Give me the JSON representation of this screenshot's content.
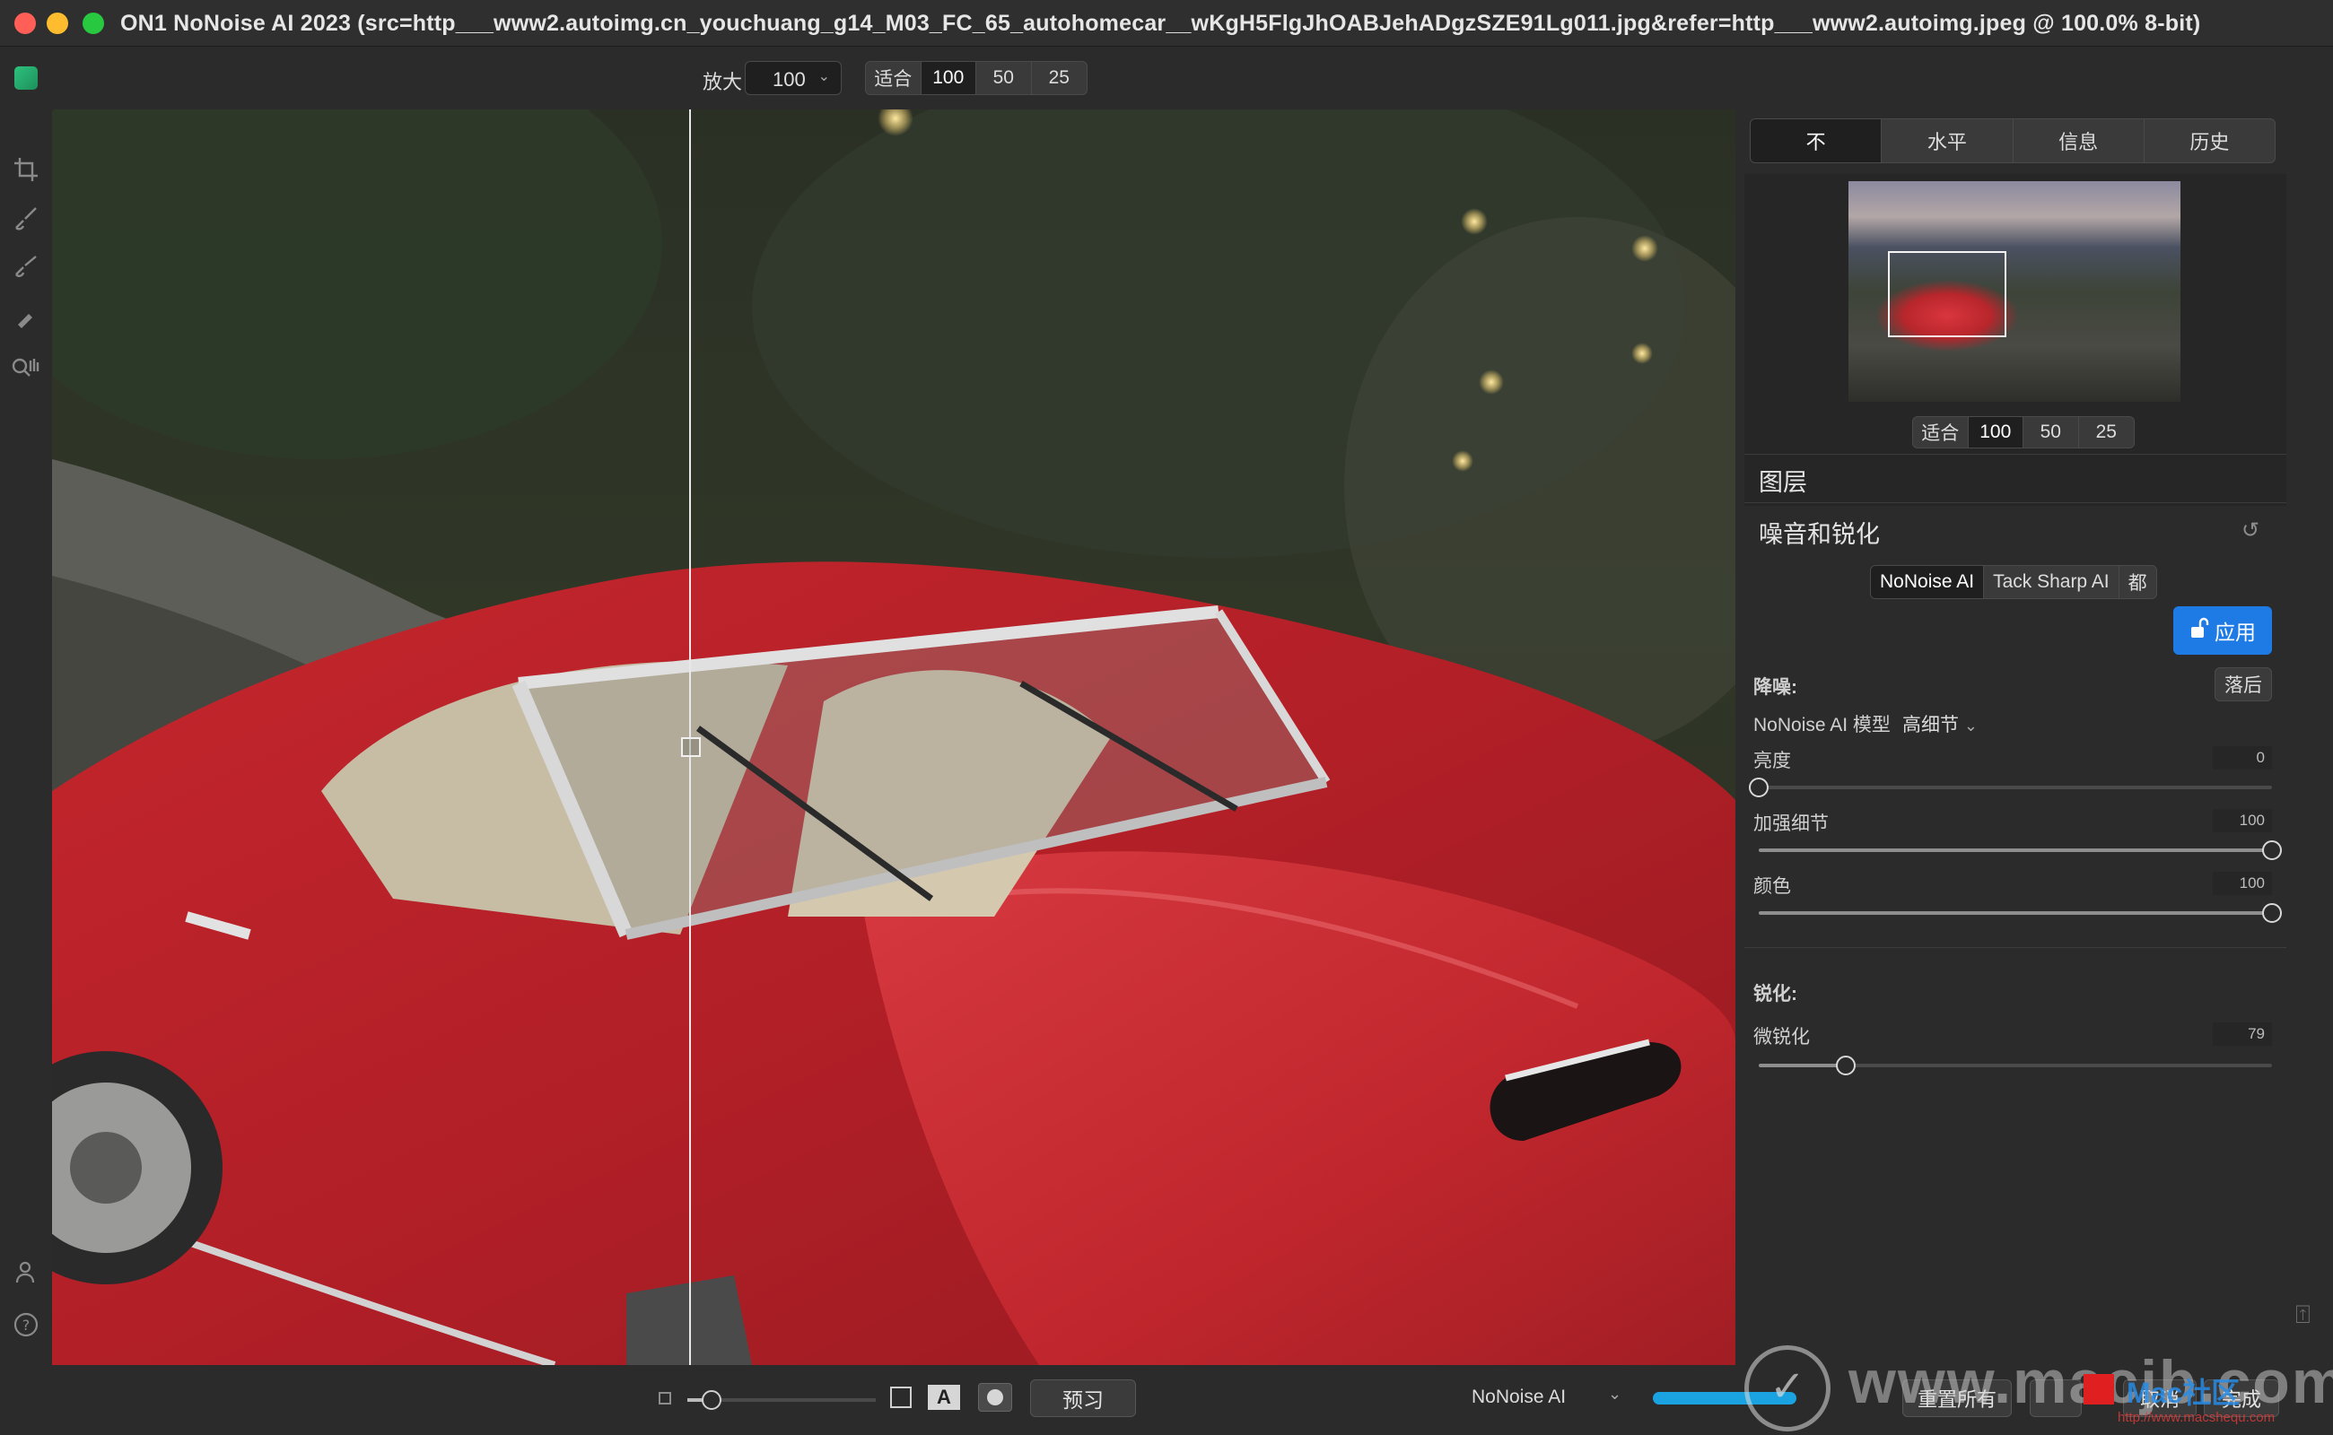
{
  "window": {
    "title": "ON1 NoNoise AI 2023 (src=http___www2.autoimg.cn_youchuang_g14_M03_FC_65_autohomecar__wKgH5FlgJhOABJehADgzSZE91Lg011.jpg&refer=http___www2.autoimg.jpeg @ 100.0% 8-bit)"
  },
  "toolbar": {
    "zoom_label": "放大",
    "zoom_value": "100",
    "zoom_presets": [
      "适合",
      "100",
      "50",
      "25"
    ],
    "zoom_active": "100"
  },
  "panel": {
    "tabs": [
      "不",
      "水平",
      "信息",
      "历史"
    ],
    "active_tab": "不",
    "navigator": {
      "zoom_presets": [
        "适合",
        "100",
        "50",
        "25"
      ],
      "zoom_active": "100"
    },
    "layers_title": "图层",
    "section_title": "噪音和锐化",
    "modes": [
      "NoNoise AI",
      "Tack Sharp AI",
      "都"
    ],
    "active_mode": "NoNoise AI",
    "apply_label": "应用",
    "denoise": {
      "heading": "降噪:",
      "reset_label": "落后",
      "model_label": "NoNoise AI 模型",
      "model_value": "高细节",
      "sliders": [
        {
          "label": "亮度",
          "value": "0",
          "percent": 0
        },
        {
          "label": "加强细节",
          "value": "100",
          "percent": 100
        },
        {
          "label": "颜色",
          "value": "100",
          "percent": 100
        }
      ]
    },
    "sharpen": {
      "heading": "锐化:",
      "sliders": [
        {
          "label": "微锐化",
          "value": "79",
          "percent": 17
        }
      ]
    }
  },
  "bottombar": {
    "opacity_percent": 13,
    "a_label": "A",
    "preview_label": "预习",
    "mode_label": "NoNoise AI",
    "reset_all_label": "重置所有",
    "cancel_label": "取消",
    "done_label": "完成"
  },
  "watermark": {
    "text": "www.macjb.com",
    "cn": "Mac社区",
    "url": "http://www.macshequ.com"
  },
  "colors": {
    "accent": "#1e7be6",
    "progress": "#1aa3e0",
    "background": "#2b2b2b"
  }
}
